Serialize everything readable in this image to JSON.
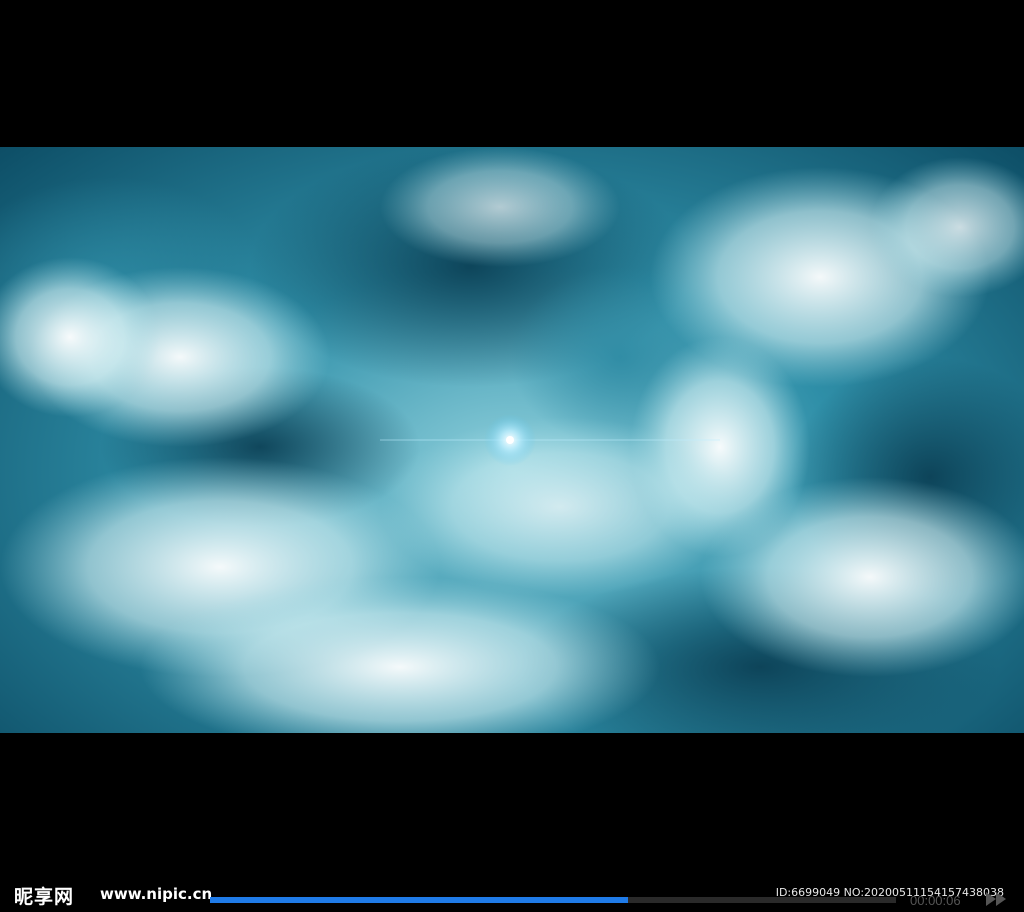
{
  "watermark": {
    "logo": "昵享网",
    "url": "www.nipic.cn"
  },
  "media_id": "ID:6699049 NO:20200511154157438038",
  "playback": {
    "elapsed": "00:00:06",
    "progress_fraction": 0.61
  },
  "colors": {
    "progress": "#1f7be8",
    "sky_dark": "#0d4e66",
    "sky_light": "#8fd0dc"
  },
  "icons": [
    "fast-forward-icon"
  ]
}
